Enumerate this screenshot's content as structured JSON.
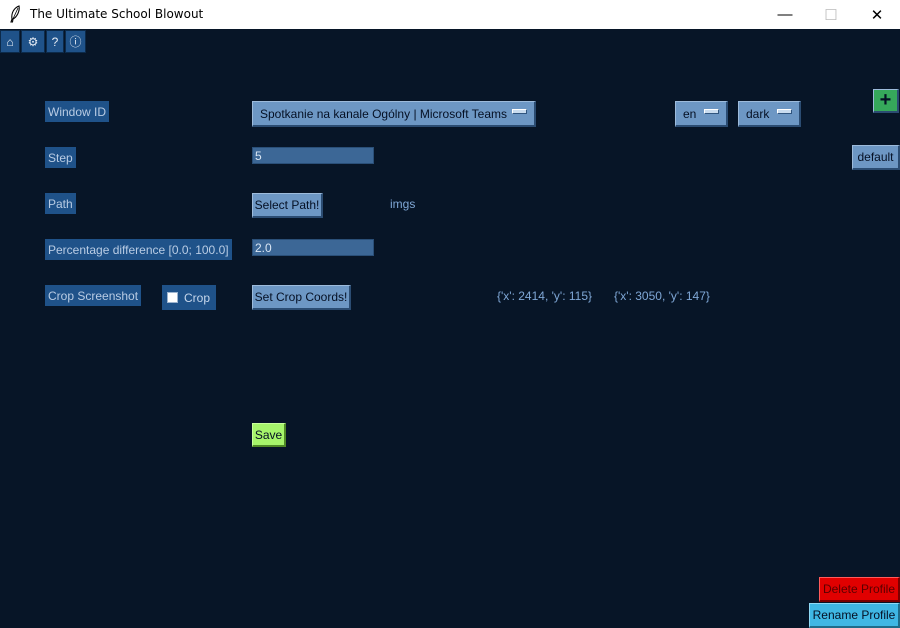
{
  "window": {
    "title": "The Ultimate School Blowout",
    "minimize": "—",
    "maximize": "☐",
    "close": "✕"
  },
  "toolbar": {
    "home_icon": "⌂",
    "settings_icon": "⚙",
    "help_icon": "?",
    "info_icon": "ⓘ"
  },
  "form": {
    "window_id": {
      "label": "Window ID",
      "value": "Spotkanie na kanale Ogólny | Microsoft Teams"
    },
    "language": "en",
    "theme": "dark",
    "add_label": "+",
    "step": {
      "label": "Step",
      "value": "5"
    },
    "default_label": "default",
    "path": {
      "label": "Path",
      "button": "Select Path!",
      "value": "imgs"
    },
    "percentage": {
      "label": "Percentage difference  [0.0; 100.0]",
      "value": "2.0"
    },
    "crop": {
      "label": "Crop Screenshot",
      "checkbox_label": "Crop",
      "checked": false,
      "button": "Set Crop Coords!",
      "coord1": "{'x': 2414, 'y': 115}",
      "coord2": "{'x': 3050, 'y': 147}"
    },
    "save_label": "Save"
  },
  "profile": {
    "delete_label": "Delete Profile",
    "rename_label": "Rename Profile"
  },
  "colors": {
    "background": "#071527",
    "label_bg": "#1f5289",
    "button_bg": "#6d97c4",
    "save_bg": "#a6f56b",
    "add_bg": "#36a85b",
    "delete_bg": "#e00000",
    "rename_bg": "#3fb7e4"
  }
}
